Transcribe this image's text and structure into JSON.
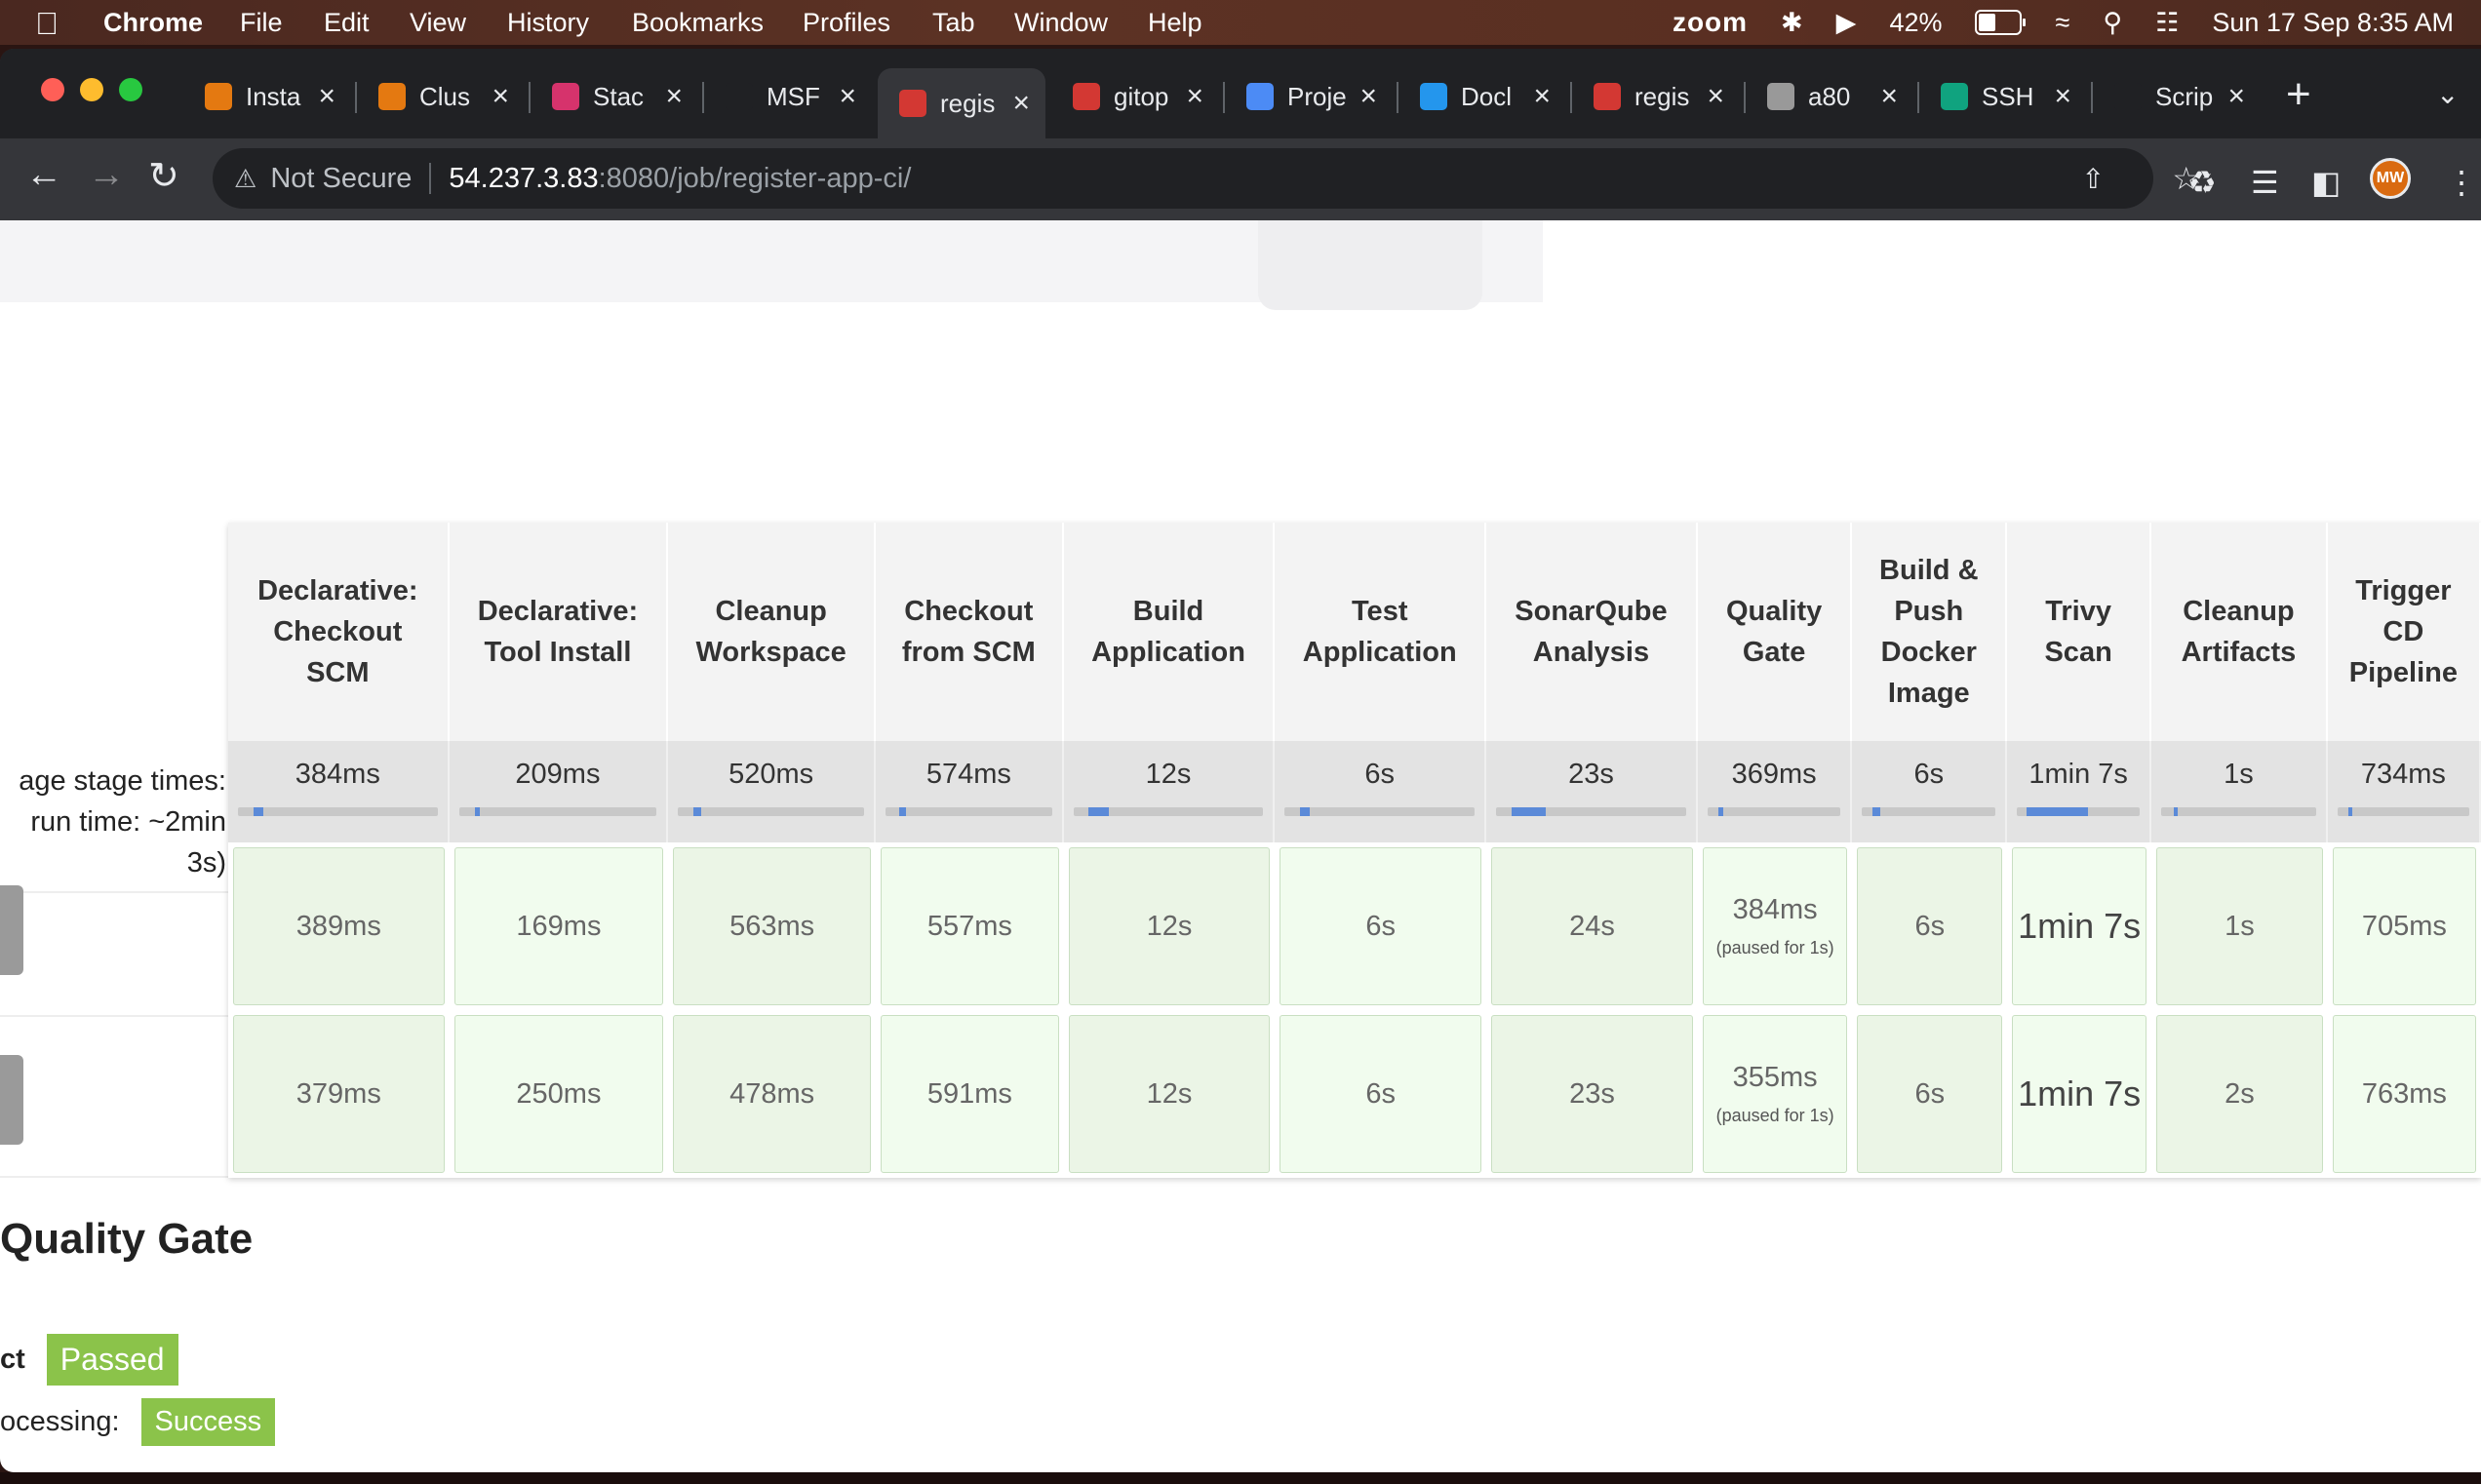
{
  "menubar": {
    "app": "Chrome",
    "menus": [
      "File",
      "Edit",
      "View",
      "History",
      "Bookmarks",
      "Profiles",
      "Tab",
      "Window",
      "Help"
    ],
    "zoom": "zoom",
    "battery": "42%",
    "datetime": "Sun 17 Sep  8:35 AM"
  },
  "tabs": [
    {
      "title": "Insta",
      "icon": "aws-icon",
      "color": "#e47911"
    },
    {
      "title": "Clus",
      "icon": "aws-icon",
      "color": "#e47911"
    },
    {
      "title": "Stac",
      "icon": "stack-icon",
      "color": "#d6336c"
    },
    {
      "title": "MSF",
      "icon": "github-icon",
      "color": "#202124"
    },
    {
      "title": "regis",
      "icon": "jenkins-icon",
      "color": "#d33833",
      "active": true
    },
    {
      "title": "gitop",
      "icon": "jenkins-icon",
      "color": "#d33833"
    },
    {
      "title": "Proje",
      "icon": "argo-icon",
      "color": "#4c8bf5"
    },
    {
      "title": "Docl",
      "icon": "docker-icon",
      "color": "#2496ed"
    },
    {
      "title": "regis",
      "icon": "sonar-icon",
      "color": "#d33833"
    },
    {
      "title": "a80",
      "icon": "image-icon",
      "color": "#999999"
    },
    {
      "title": "SSH",
      "icon": "openai-icon",
      "color": "#10a37f"
    },
    {
      "title": "Scrip",
      "icon": "github-icon",
      "color": "#202124"
    }
  ],
  "address": {
    "security": "Not Secure",
    "host": "54.237.3.83",
    "path": ":8080/job/register-app-ci/"
  },
  "profile_initials": "MW",
  "left": {
    "avg_label_1": "age stage times:",
    "avg_label_2": "run time: ~2min",
    "avg_label_3": "3s)"
  },
  "stages": [
    {
      "name": "Declarative: Checkout SCM",
      "avg": "384ms",
      "bar": 0.05
    },
    {
      "name": "Declarative: Tool Install",
      "avg": "209ms",
      "bar": 0.03
    },
    {
      "name": "Cleanup Workspace",
      "avg": "520ms",
      "bar": 0.05
    },
    {
      "name": "Checkout from SCM",
      "avg": "574ms",
      "bar": 0.05
    },
    {
      "name": "Build Application",
      "avg": "12s",
      "bar": 0.12
    },
    {
      "name": "Test Application",
      "avg": "6s",
      "bar": 0.06
    },
    {
      "name": "SonarQube Analysis",
      "avg": "23s",
      "bar": 0.2
    },
    {
      "name": "Quality Gate",
      "avg": "369ms",
      "bar": 0.04
    },
    {
      "name": "Build & Push Docker Image",
      "avg": "6s",
      "bar": 0.06
    },
    {
      "name": "Trivy Scan",
      "avg": "1min 7s",
      "bar": 0.55
    },
    {
      "name": "Cleanup Artifacts",
      "avg": "1s",
      "bar": 0.03
    },
    {
      "name": "Trigger CD Pipeline",
      "avg": "734ms",
      "bar": 0.04
    }
  ],
  "runs": [
    {
      "cells": [
        "389ms",
        "169ms",
        "563ms",
        "557ms",
        "12s",
        "6s",
        "24s",
        "384ms",
        "6s",
        "1min 7s",
        "1s",
        "705ms"
      ],
      "paused": "(paused for 1s)"
    },
    {
      "cells": [
        "379ms",
        "250ms",
        "478ms",
        "591ms",
        "12s",
        "6s",
        "23s",
        "355ms",
        "6s",
        "1min 7s",
        "2s",
        "763ms"
      ],
      "paused": "(paused for 1s)"
    }
  ],
  "quality_gate": {
    "title": "Quality Gate",
    "status_label": "ct",
    "status": "Passed",
    "processing_label": "ocessing:",
    "processing": "Success"
  }
}
